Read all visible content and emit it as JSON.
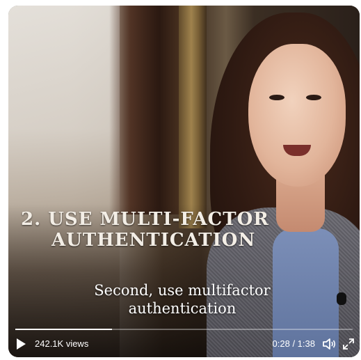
{
  "video": {
    "title_line1": "2. Use Multi-Factor",
    "title_line2": "Authentication",
    "caption": "Second, use multifactor authentication",
    "views": "242.1K views",
    "time": "0:28 / 1:38",
    "progress_fraction": 0.286
  },
  "icons": {
    "play": "play-icon",
    "volume": "speaker-icon",
    "fullscreen": "expand-icon"
  },
  "colors": {
    "control_text": "#ffffff",
    "progress_fill": "#ffffff",
    "progress_track": "rgba(255,255,255,0.35)"
  }
}
